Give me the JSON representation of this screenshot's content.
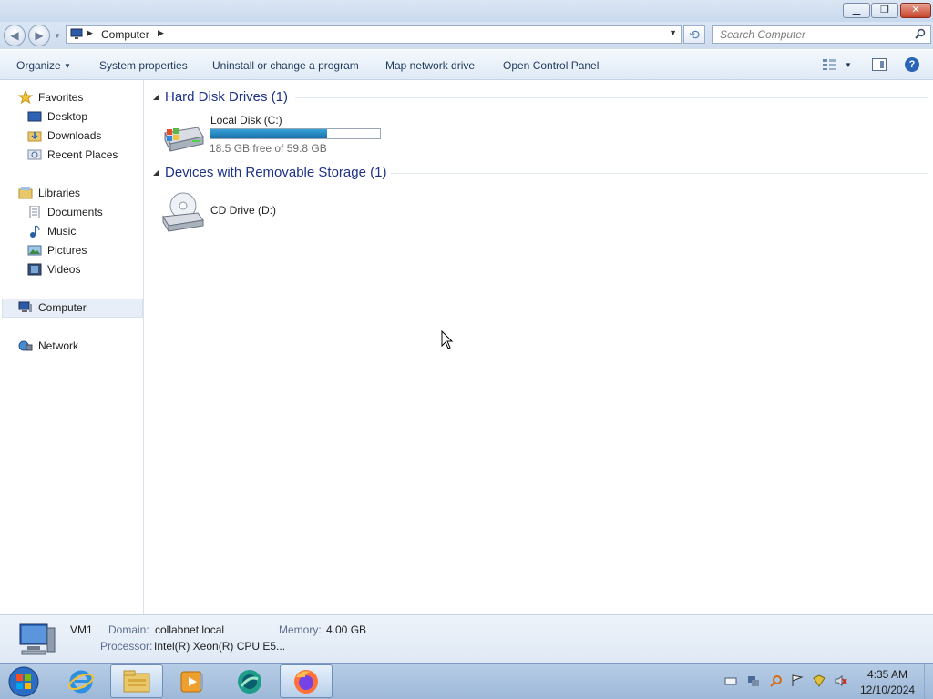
{
  "window": {
    "minimize_icon": "minimize-icon",
    "maximize_icon": "restore-icon",
    "close_icon": "close-icon"
  },
  "address": {
    "location": "Computer",
    "search_placeholder": "Search Computer"
  },
  "toolbar": {
    "organize": "Organize",
    "system_properties": "System properties",
    "uninstall": "Uninstall or change a program",
    "map_network_drive": "Map network drive",
    "open_control_panel": "Open Control Panel"
  },
  "nav": {
    "favorites": "Favorites",
    "desktop": "Desktop",
    "downloads": "Downloads",
    "recent_places": "Recent Places",
    "libraries": "Libraries",
    "documents": "Documents",
    "music": "Music",
    "pictures": "Pictures",
    "videos": "Videos",
    "computer": "Computer",
    "network": "Network"
  },
  "groups": {
    "hard_disks": {
      "title": "Hard Disk Drives (1)",
      "drive_name": "Local Disk (C:)",
      "free_text": "18.5 GB free of 59.8 GB",
      "used_fraction": 0.69
    },
    "removable": {
      "title": "Devices with Removable Storage (1)",
      "drive_name": "CD Drive (D:)"
    }
  },
  "details": {
    "computer_name": "VM1",
    "domain_label": "Domain:",
    "domain_value": "collabnet.local",
    "memory_label": "Memory:",
    "memory_value": "4.00 GB",
    "processor_label": "Processor:",
    "processor_value": "Intel(R) Xeon(R) CPU E5..."
  },
  "taskbar": {
    "time": "4:35 AM",
    "date": "12/10/2024"
  },
  "colors": {
    "accent": "#1e3287",
    "capacity_fill": "#1b6fa8",
    "taskbar": "#9db8d8"
  }
}
